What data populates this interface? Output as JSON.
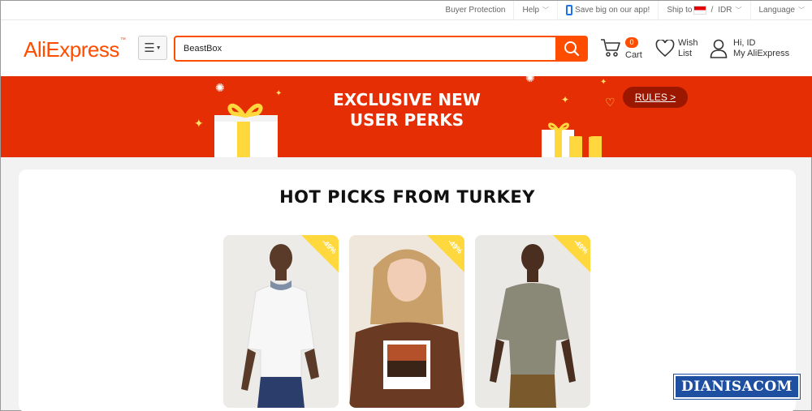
{
  "topbar": {
    "buyer_protection": "Buyer Protection",
    "help": "Help",
    "app_promo": "Save big on our app!",
    "ship_to": "Ship to",
    "ship_separator": "/",
    "currency": "IDR",
    "language": "Language"
  },
  "header": {
    "logo": "AliExpress",
    "logo_tm": "™",
    "search_value": "BeastBox",
    "cart_count": "0",
    "cart_label": "Cart",
    "wish_line1": "Wish",
    "wish_line2": "List",
    "account_line1": "Hi, ID",
    "account_line2": "My AliExpress"
  },
  "banner": {
    "title_line1": "EXCLUSIVE NEW",
    "title_line2": "USER PERKS",
    "rules_label": "RULES >"
  },
  "section": {
    "title": "HOT PICKS FROM TURKEY",
    "products": [
      {
        "discount": "-49%",
        "image": "man in white polo shirt"
      },
      {
        "discount": "-49%",
        "image": "woman in brown graphic t-shirt"
      },
      {
        "discount": "-49%",
        "image": "man in olive t-shirt"
      }
    ]
  },
  "watermark": "DIANISACOM",
  "colors": {
    "brand": "#ff4d00",
    "banner": "#e62e04",
    "rules": "#9b1700",
    "discount": "#ffd83d",
    "watermark": "#1e4fa0"
  }
}
